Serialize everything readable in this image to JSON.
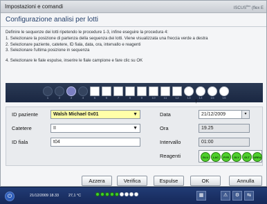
{
  "window": {
    "title": "Impostazioni e comandi",
    "brand": "ISCUS",
    "brand_sup": "flex",
    "brand_suffix": "(flex E",
    "subtitle": "Configurazione analisi per lotti"
  },
  "instructions": {
    "line1": "Definire le sequenze dei lotti ripetendo le procedure 1-3, infine eseguire la procedura 4:",
    "line2": "1. Selezionare la posizione di partenza della sequenza dei lotti. Viene visualizzata una freccia verde a destra",
    "line3": "2. Selezionare paziente, catetere, ID fiala, data, ora, intervallo e reagenti",
    "line4": "3. Selezionare l'ultima posizione in sequenza",
    "line5": "4. Selezionare le fiale espulse, inserire le fiale campione e fare clic su OK"
  },
  "tray": {
    "positions": [
      "1",
      "2",
      "3",
      "4",
      "5",
      "6",
      "7",
      "8",
      "9",
      "10",
      "11",
      "12",
      "13",
      "14",
      "15",
      "16"
    ]
  },
  "form": {
    "patient_label": "ID paziente",
    "patient_value": "Walsh Michael 0x01",
    "catheter_label": "Catetere",
    "catheter_value": "II",
    "vial_label": "ID fiala",
    "vial_value": "t04",
    "date_label": "Data",
    "date_value": "21/12/2009",
    "time_label": "Ora",
    "time_value": "19.25",
    "interval_label": "Intervallo",
    "interval_value": "01:00",
    "reagents_label": "Reagenti",
    "reagents": [
      "GLU",
      "LAC",
      "PYR",
      "GLY",
      "GLT",
      "UREA"
    ]
  },
  "buttons": {
    "clear": "Azzera",
    "verify": "Verifica",
    "eject": "Espulse",
    "ok": "OK",
    "cancel": "Annulla"
  },
  "taskbar": {
    "datetime": "21/12/2009 18.33",
    "temperature": "27,1 °C"
  },
  "colors": {
    "reagent_green": "#4fcf2c",
    "patient_highlight": "#ffffa8",
    "tray_dark": "#1a2742"
  }
}
